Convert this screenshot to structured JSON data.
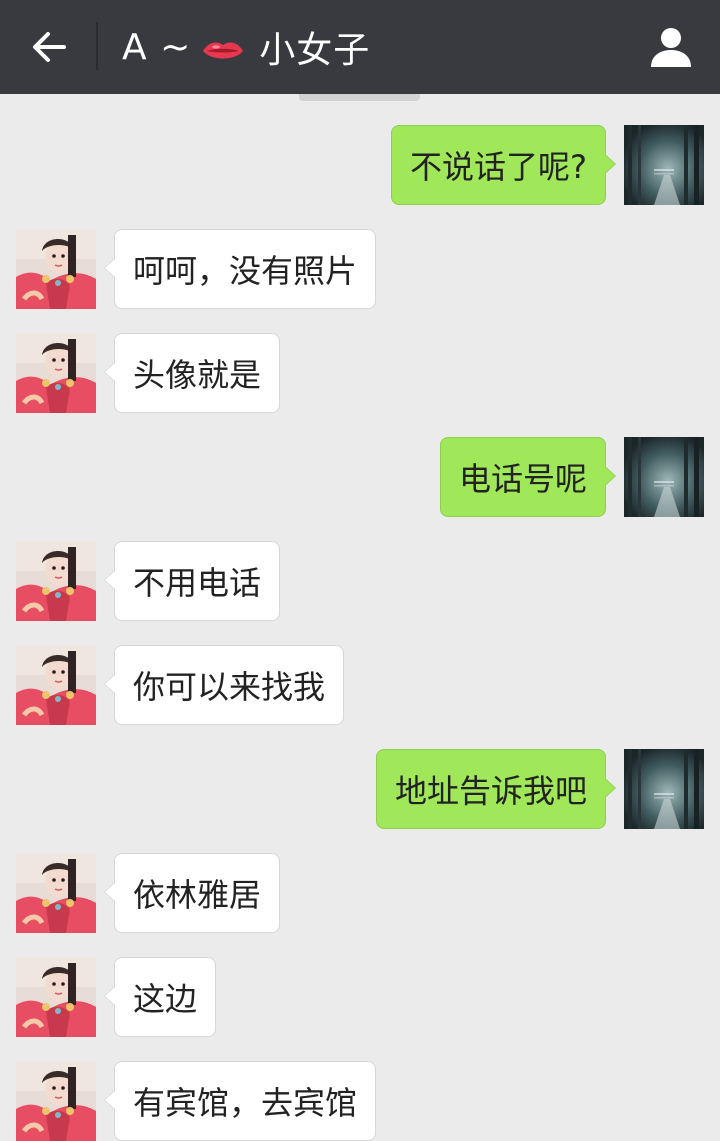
{
  "header": {
    "title_prefix": "A ~",
    "title_name": "小女子",
    "lips_icon": "lips-emoji",
    "back_icon": "back-arrow-icon",
    "profile_icon": "person-icon"
  },
  "colors": {
    "header_bg": "#393a3f",
    "chat_bg": "#ebebeb",
    "outgoing_bubble": "#a0e75a",
    "incoming_bubble": "#ffffff"
  },
  "messages": [
    {
      "side": "right",
      "text": "不说话了呢?"
    },
    {
      "side": "left",
      "text": "呵呵，没有照片"
    },
    {
      "side": "left",
      "text": "头像就是"
    },
    {
      "side": "right",
      "text": "电话号呢"
    },
    {
      "side": "left",
      "text": "不用电话"
    },
    {
      "side": "left",
      "text": "你可以来找我"
    },
    {
      "side": "right",
      "text": "地址告诉我吧"
    },
    {
      "side": "left",
      "text": "依林雅居"
    },
    {
      "side": "left",
      "text": "这边"
    },
    {
      "side": "left",
      "text": "有宾馆，去宾馆"
    }
  ]
}
